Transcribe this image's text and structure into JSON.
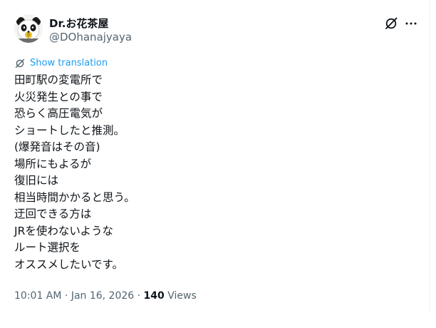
{
  "author": {
    "display_name": "Dr.お花茶屋",
    "handle": "@DOhanajyaya",
    "avatar_icon": "panda-avatar-icon"
  },
  "actions": {
    "grok_icon": "grok-slash-icon",
    "more_icon": "more-dots-icon"
  },
  "translation": {
    "label": "Show translation",
    "icon": "grok-slash-icon"
  },
  "tweet": {
    "lines": [
      "田町駅の変電所で",
      "火災発生との事で",
      "恐らく高圧電気が",
      "ショートしたと推測。",
      "(爆発音はその音)",
      "場所にもよるが",
      "復旧には",
      "相当時間かかると思う。",
      "迂回できる方は",
      "JRを使わないような",
      "ルート選択を",
      "オススメしたいです。"
    ]
  },
  "meta": {
    "time": "10:01 AM",
    "separator": " · ",
    "date": "Jan 16, 2026",
    "views_count": "140",
    "views_label": "Views"
  },
  "colors": {
    "text": "#0f1419",
    "secondary": "#536471",
    "link": "#1d9bf0"
  }
}
